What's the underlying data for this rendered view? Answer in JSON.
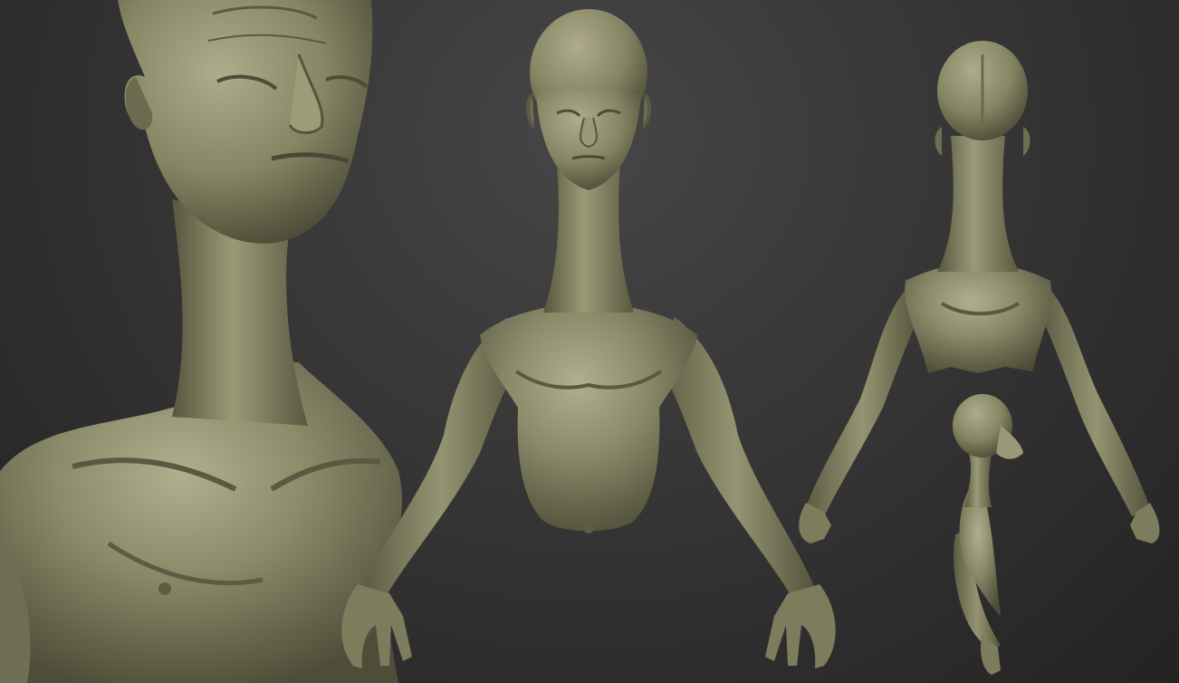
{
  "scene": {
    "background_color": "#353535",
    "model_color": "#8a8a68",
    "model_shadow_color": "#4b4b36",
    "model_highlight_color": "#b4b491",
    "views": [
      {
        "id": "closeup-front",
        "description_icon": "bust-closeup"
      },
      {
        "id": "front-view",
        "description_icon": "bust-front"
      },
      {
        "id": "back-view",
        "description_icon": "bust-back"
      },
      {
        "id": "side-view",
        "description_icon": "bust-side"
      }
    ]
  }
}
